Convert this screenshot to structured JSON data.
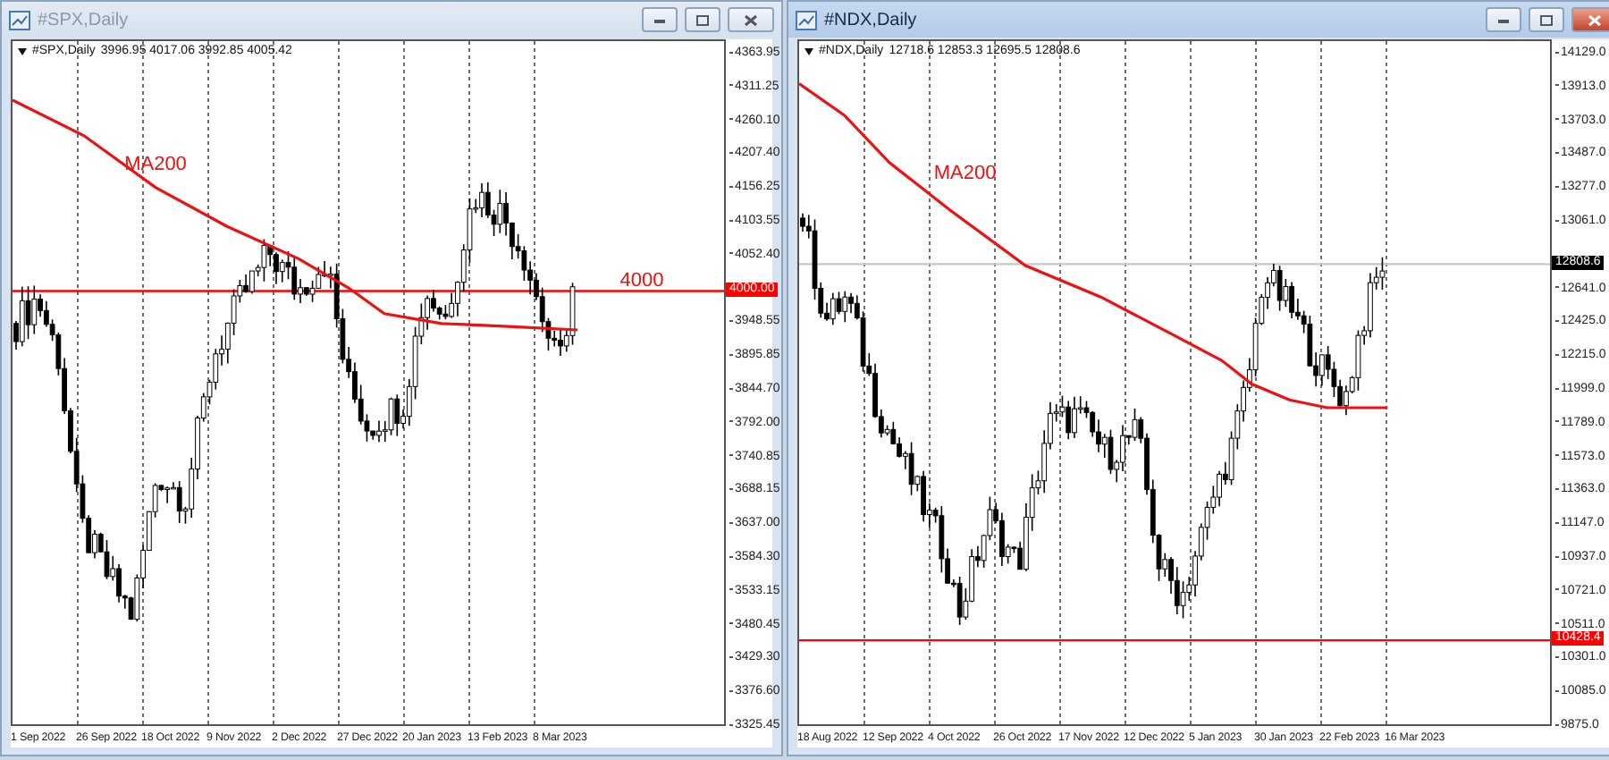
{
  "windows": [
    {
      "title": "#SPX,Daily",
      "active": false,
      "symbol": "#SPX,Daily",
      "ohlc": "3996.95 4017.06 3992.85 4005.42",
      "y_labels": [
        "4363.95",
        "4311.25",
        "4260.10",
        "4207.40",
        "4156.25",
        "4103.55",
        "4052.40",
        "3948.55",
        "3895.85",
        "3844.70",
        "3792.00",
        "3740.85",
        "3688.15",
        "3637.00",
        "3584.30",
        "3533.15",
        "3480.45",
        "3429.30",
        "3376.60",
        "3325.45"
      ],
      "price_tags": [
        {
          "text": "4000.00",
          "color": "#ff0000"
        }
      ],
      "annotations": [
        "MA200",
        "4000"
      ],
      "x_labels": [
        "1 Sep 2022",
        "26 Sep 2022",
        "18 Oct 2022",
        "9 Nov 2022",
        "2 Dec 2022",
        "27 Dec 2022",
        "20 Jan 2023",
        "13 Feb 2023",
        "8 Mar 2023"
      ]
    },
    {
      "title": "#NDX,Daily",
      "active": true,
      "symbol": "#NDX,Daily",
      "ohlc": "12718.6 12853.3 12695.5 12808.6",
      "y_labels": [
        "14129.0",
        "13913.0",
        "13703.0",
        "13487.0",
        "13277.0",
        "13061.0",
        "12641.0",
        "12425.0",
        "12215.0",
        "11999.0",
        "11789.0",
        "11573.0",
        "11363.0",
        "11147.0",
        "10937.0",
        "10721.0",
        "10511.0",
        "10301.0",
        "10085.0",
        "9875.0"
      ],
      "price_tags": [
        {
          "text": "12808.6",
          "color": "#000000"
        },
        {
          "text": "10428.4",
          "color": "#ff0000"
        }
      ],
      "annotations": [
        "MA200"
      ],
      "x_labels": [
        "18 Aug 2022",
        "12 Sep 2022",
        "4 Oct 2022",
        "26 Oct 2022",
        "17 Nov 2022",
        "12 Dec 2022",
        "5 Jan 2023",
        "30 Jan 2023",
        "22 Feb 2023",
        "16 Mar 2023"
      ]
    }
  ]
}
